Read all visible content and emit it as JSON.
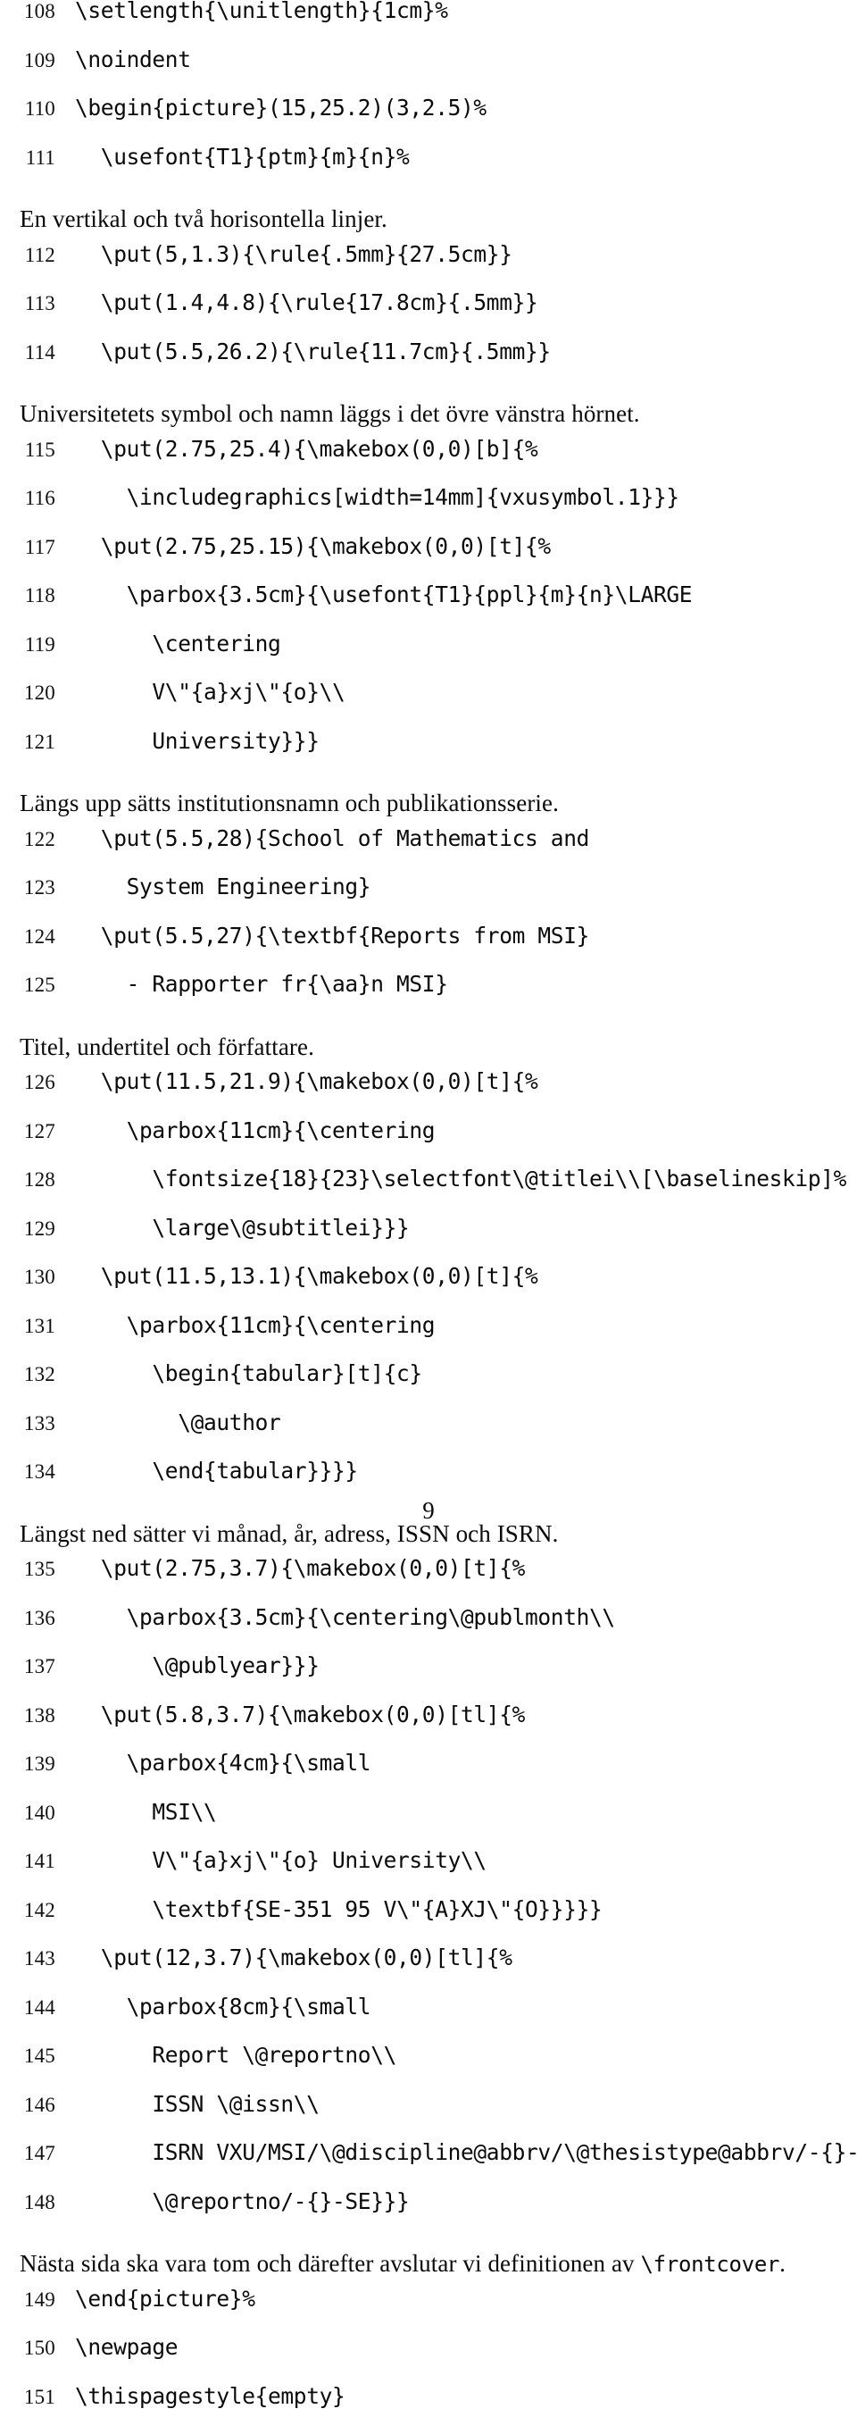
{
  "page": {
    "folio": "9"
  },
  "blocks": [
    {
      "kind": "code",
      "lineno": "108",
      "text": "\\setlength{\\unitlength}{1cm}%"
    },
    {
      "kind": "code",
      "lineno": "109",
      "text": "\\noindent"
    },
    {
      "kind": "code",
      "lineno": "110",
      "text": "\\begin{picture}(15,25.2)(3,2.5)%"
    },
    {
      "kind": "code",
      "lineno": "111",
      "text": "  \\usefont{T1}{ptm}{m}{n}%"
    },
    {
      "kind": "prose",
      "text": "En vertikal och två horisontella linjer."
    },
    {
      "kind": "code",
      "lineno": "112",
      "text": "  \\put(5,1.3){\\rule{.5mm}{27.5cm}}"
    },
    {
      "kind": "code",
      "lineno": "113",
      "text": "  \\put(1.4,4.8){\\rule{17.8cm}{.5mm}}"
    },
    {
      "kind": "code",
      "lineno": "114",
      "text": "  \\put(5.5,26.2){\\rule{11.7cm}{.5mm}}"
    },
    {
      "kind": "prose",
      "text": "Universitetets symbol och namn läggs i det övre vänstra hörnet."
    },
    {
      "kind": "code",
      "lineno": "115",
      "text": "  \\put(2.75,25.4){\\makebox(0,0)[b]{%"
    },
    {
      "kind": "code",
      "lineno": "116",
      "text": "    \\includegraphics[width=14mm]{vxusymbol.1}}}"
    },
    {
      "kind": "code",
      "lineno": "117",
      "text": "  \\put(2.75,25.15){\\makebox(0,0)[t]{%"
    },
    {
      "kind": "code",
      "lineno": "118",
      "text": "    \\parbox{3.5cm}{\\usefont{T1}{ppl}{m}{n}\\LARGE"
    },
    {
      "kind": "code",
      "lineno": "119",
      "text": "      \\centering"
    },
    {
      "kind": "code",
      "lineno": "120",
      "text": "      V\\\"{a}xj\\\"{o}\\\\"
    },
    {
      "kind": "code",
      "lineno": "121",
      "text": "      University}}}"
    },
    {
      "kind": "prose",
      "text": "Längs upp sätts institutionsnamn och publikationsserie."
    },
    {
      "kind": "code",
      "lineno": "122",
      "text": "  \\put(5.5,28){School of Mathematics and"
    },
    {
      "kind": "code",
      "lineno": "123",
      "text": "    System Engineering}"
    },
    {
      "kind": "code",
      "lineno": "124",
      "text": "  \\put(5.5,27){\\textbf{Reports from MSI}"
    },
    {
      "kind": "code",
      "lineno": "125",
      "text": "    - Rapporter fr{\\aa}n MSI}"
    },
    {
      "kind": "prose",
      "text": "Titel, undertitel och författare."
    },
    {
      "kind": "code",
      "lineno": "126",
      "text": "  \\put(11.5,21.9){\\makebox(0,0)[t]{%"
    },
    {
      "kind": "code",
      "lineno": "127",
      "text": "    \\parbox{11cm}{\\centering"
    },
    {
      "kind": "code",
      "lineno": "128",
      "text": "      \\fontsize{18}{23}\\selectfont\\@titlei\\\\[\\baselineskip]%"
    },
    {
      "kind": "code",
      "lineno": "129",
      "text": "      \\large\\@subtitlei}}}"
    },
    {
      "kind": "code",
      "lineno": "130",
      "text": "  \\put(11.5,13.1){\\makebox(0,0)[t]{%"
    },
    {
      "kind": "code",
      "lineno": "131",
      "text": "    \\parbox{11cm}{\\centering"
    },
    {
      "kind": "code",
      "lineno": "132",
      "text": "      \\begin{tabular}[t]{c}"
    },
    {
      "kind": "code",
      "lineno": "133",
      "text": "        \\@author"
    },
    {
      "kind": "code",
      "lineno": "134",
      "text": "      \\end{tabular}}}}"
    },
    {
      "kind": "prose_isrn",
      "before": "Längst ned sätter vi månad, år, adress, ",
      "sc1": "ISSN",
      "middle": " och ",
      "sc2": "ISRN",
      "after": "."
    },
    {
      "kind": "code",
      "lineno": "135",
      "text": "  \\put(2.75,3.7){\\makebox(0,0)[t]{%"
    },
    {
      "kind": "code",
      "lineno": "136",
      "text": "    \\parbox{3.5cm}{\\centering\\@publmonth\\\\"
    },
    {
      "kind": "code",
      "lineno": "137",
      "text": "      \\@publyear}}}"
    },
    {
      "kind": "code",
      "lineno": "138",
      "text": "  \\put(5.8,3.7){\\makebox(0,0)[tl]{%"
    },
    {
      "kind": "code",
      "lineno": "139",
      "text": "    \\parbox{4cm}{\\small"
    },
    {
      "kind": "code",
      "lineno": "140",
      "text": "      MSI\\\\"
    },
    {
      "kind": "code",
      "lineno": "141",
      "text": "      V\\\"{a}xj\\\"{o} University\\\\"
    },
    {
      "kind": "code",
      "lineno": "142",
      "text": "      \\textbf{SE-351 95 V\\\"{A}XJ\\\"{O}}}}}"
    },
    {
      "kind": "code",
      "lineno": "143",
      "text": "  \\put(12,3.7){\\makebox(0,0)[tl]{%"
    },
    {
      "kind": "code",
      "lineno": "144",
      "text": "    \\parbox{8cm}{\\small"
    },
    {
      "kind": "code",
      "lineno": "145",
      "text": "      Report \\@reportno\\\\"
    },
    {
      "kind": "code",
      "lineno": "146",
      "text": "      ISSN \\@issn\\\\"
    },
    {
      "kind": "code",
      "lineno": "147",
      "text": "      ISRN VXU/MSI/\\@discipline@abbrv/\\@thesistype@abbrv/-{}-%"
    },
    {
      "kind": "code",
      "lineno": "148",
      "text": "      \\@reportno/-{}-SE}}}"
    },
    {
      "kind": "prose_frontcover",
      "before": "Nästa sida ska vara tom och därefter avslutar vi definitionen av ",
      "tt": "\\frontcover",
      "after": "."
    },
    {
      "kind": "code",
      "lineno": "149",
      "text": "\\end{picture}%"
    },
    {
      "kind": "code",
      "lineno": "150",
      "text": "\\newpage"
    },
    {
      "kind": "code",
      "lineno": "151",
      "text": "\\thispagestyle{empty}"
    }
  ]
}
